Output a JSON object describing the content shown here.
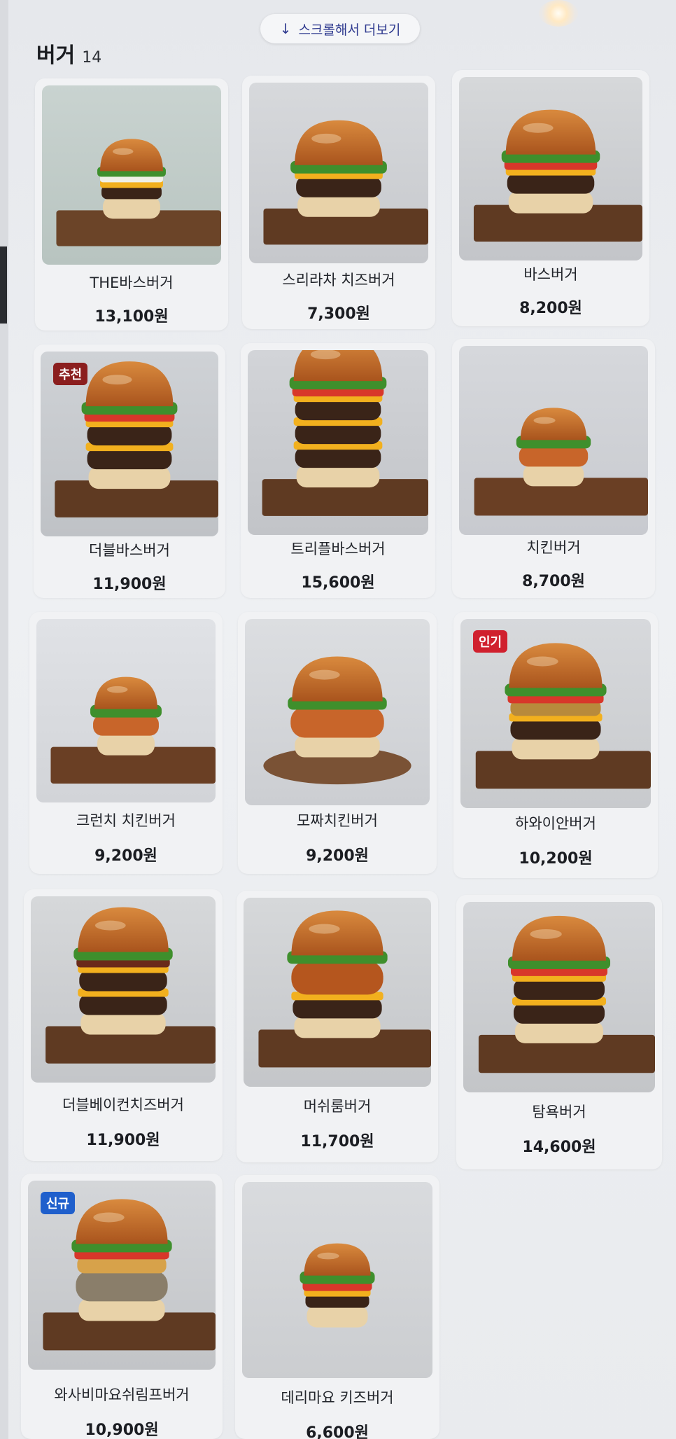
{
  "scroll_hint": {
    "icon": "arrow-down-icon",
    "label": "스크롤해서 더보기"
  },
  "category": {
    "name": "버거",
    "count": "14"
  },
  "badge_colors": {
    "추천": "#8b1e1e",
    "인기": "#d0202e",
    "신규": "#1f5fcc"
  },
  "menu_items": [
    {
      "name": "THE바스버거",
      "price": "13,100원",
      "badge": ""
    },
    {
      "name": "스리라차 치즈버거",
      "price": "7,300원",
      "badge": ""
    },
    {
      "name": "바스버거",
      "price": "8,200원",
      "badge": ""
    },
    {
      "name": "더블바스버거",
      "price": "11,900원",
      "badge": "추천"
    },
    {
      "name": "트리플바스버거",
      "price": "15,600원",
      "badge": ""
    },
    {
      "name": "치킨버거",
      "price": "8,700원",
      "badge": ""
    },
    {
      "name": "크런치 치킨버거",
      "price": "9,200원",
      "badge": ""
    },
    {
      "name": "모짜치킨버거",
      "price": "9,200원",
      "badge": ""
    },
    {
      "name": "하와이안버거",
      "price": "10,200원",
      "badge": "인기"
    },
    {
      "name": "더블베이컨치즈버거",
      "price": "11,900원",
      "badge": ""
    },
    {
      "name": "머쉬룸버거",
      "price": "11,700원",
      "badge": ""
    },
    {
      "name": "탐욕버거",
      "price": "14,600원",
      "badge": ""
    },
    {
      "name": "와사비마요쉬림프버거",
      "price": "10,900원",
      "badge": "신규"
    },
    {
      "name": "데리마요 키즈버거",
      "price": "6,600원",
      "badge": ""
    }
  ]
}
